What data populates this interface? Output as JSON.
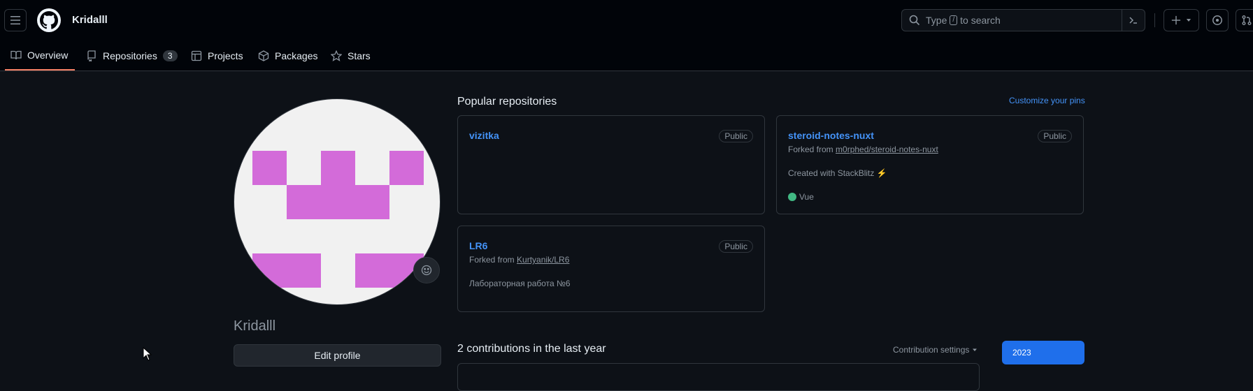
{
  "header": {
    "username": "Kridalll",
    "search_prefix": "Type",
    "search_key": "/",
    "search_suffix": "to search"
  },
  "tabs": [
    {
      "label": "Overview",
      "icon": "book-icon"
    },
    {
      "label": "Repositories",
      "icon": "repo-icon",
      "count": "3"
    },
    {
      "label": "Projects",
      "icon": "table-icon"
    },
    {
      "label": "Packages",
      "icon": "package-icon"
    },
    {
      "label": "Stars",
      "icon": "star-icon"
    }
  ],
  "profile": {
    "display_name": "Kridalll",
    "edit_label": "Edit profile"
  },
  "popular": {
    "title": "Popular repositories",
    "customize_label": "Customize your pins",
    "repos": [
      {
        "name": "vizitka",
        "visibility": "Public"
      },
      {
        "name": "steroid-notes-nuxt",
        "visibility": "Public",
        "forked_prefix": "Forked from",
        "forked_from": "m0rphed/steroid-notes-nuxt",
        "description": "Created with StackBlitz ⚡",
        "language": "Vue",
        "language_color": "#41b883"
      },
      {
        "name": "LR6",
        "visibility": "Public",
        "forked_prefix": "Forked from",
        "forked_from": "Kurtyanik/LR6",
        "description": "Лабораторная работа №6"
      }
    ]
  },
  "contributions": {
    "title": "2 contributions in the last year",
    "settings_label": "Contribution settings",
    "year": "2023"
  },
  "colors": {
    "accent": "#4493f8",
    "avatar_pink": "#d36bd9",
    "tab_underline": "#f78166"
  }
}
